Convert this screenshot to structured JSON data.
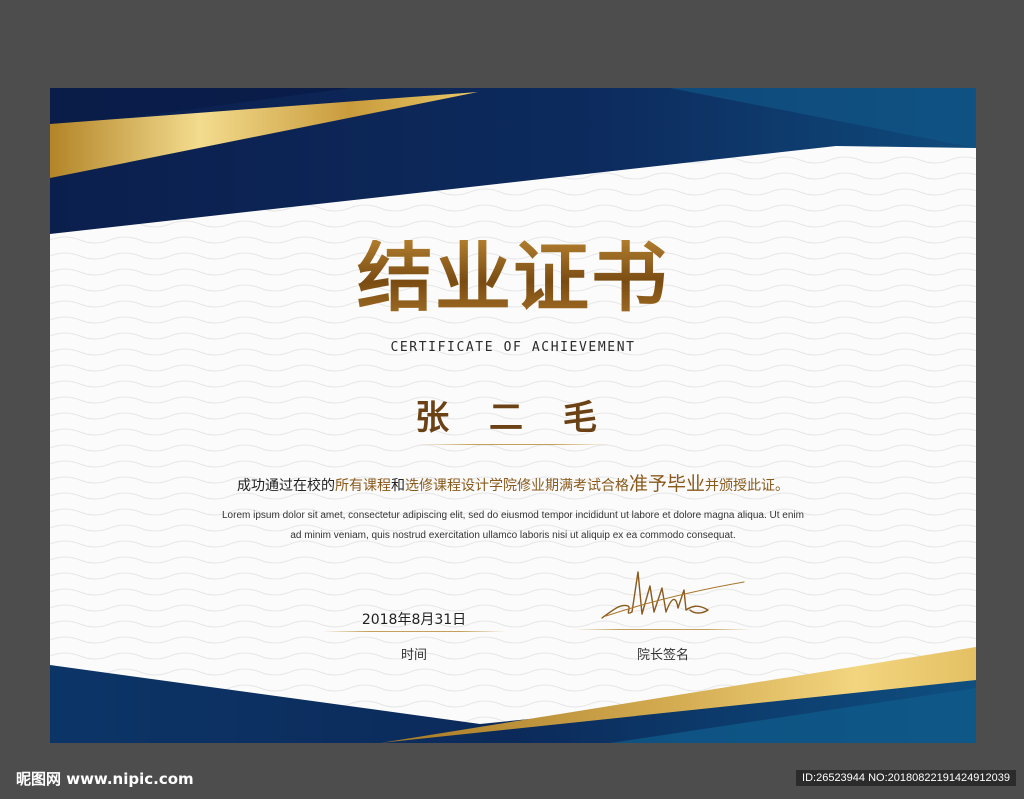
{
  "certificate": {
    "title": "结业证书",
    "subtitle": "CERTIFICATE OF ACHIEVEMENT",
    "recipient": "张 二 毛",
    "statement": {
      "part1": "成功通过在校的",
      "part2": "所有课程",
      "part3": "和",
      "part4": "选修课程设计学院修业期满考试合格",
      "part5": "准予毕业",
      "part6": "并颁授此证。"
    },
    "lorem_line1": "Lorem ipsum dolor sit amet, consectetur adipiscing elit, sed do eiusmod tempor incididunt ut labore et dolore magna aliqua. Ut enim",
    "lorem_line2": "ad minim veniam, quis nostrud exercitation ullamco laboris nisi ut aliquip ex ea commodo consequat.",
    "date_value": "2018年8月31日",
    "date_label": "时间",
    "sign_label": "院长签名"
  },
  "footer": {
    "site": "昵图网 www.nipic.com",
    "id_text": "ID:26523944 NO:20180822191424912039"
  },
  "colors": {
    "navy": "#0f2a5a",
    "teal_navy": "#0d4a78",
    "gold": "#c9a24a",
    "brown_gold": "#8a5a1c"
  }
}
